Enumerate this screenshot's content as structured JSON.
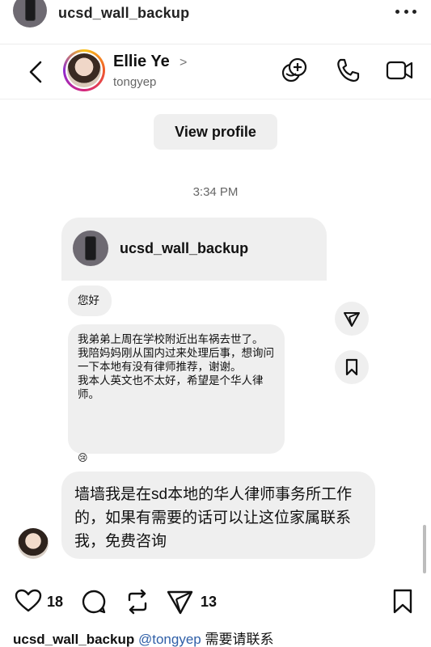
{
  "post": {
    "username": "ucsd_wall_backup",
    "likes": "18",
    "shares": "13",
    "caption_user": "ucsd_wall_backup",
    "caption_mention": "@tongyep",
    "caption_text": "需要请联系"
  },
  "dm": {
    "contact_name": "Ellie Ye",
    "contact_handle": "tongyep",
    "view_profile_label": "View profile",
    "timestamp": "3:34 PM",
    "shared_card_user": "ucsd_wall_backup",
    "messages": {
      "greeting": "您好",
      "line1": "我弟弟上周在学校附近出车祸去世了。",
      "line2": "我陪妈妈刚从国内过来处理后事，想询问一下本地有没有律师推荐，谢谢。",
      "line3": "我本人英文也不太好，希望是个华人律师。",
      "reaction": "😢",
      "reply": "墙墙我是在sd本地的华人律师事务所工作的，如果有需要的话可以让这位家属联系我，免费咨询"
    }
  },
  "icons": {
    "more": "more-icon",
    "back": "back-arrow-icon",
    "add_person": "add-person-icon",
    "call": "phone-icon",
    "video": "video-icon",
    "share": "send-icon",
    "save": "bookmark-icon",
    "like": "heart-icon",
    "comment": "comment-icon",
    "repost": "repost-icon"
  }
}
